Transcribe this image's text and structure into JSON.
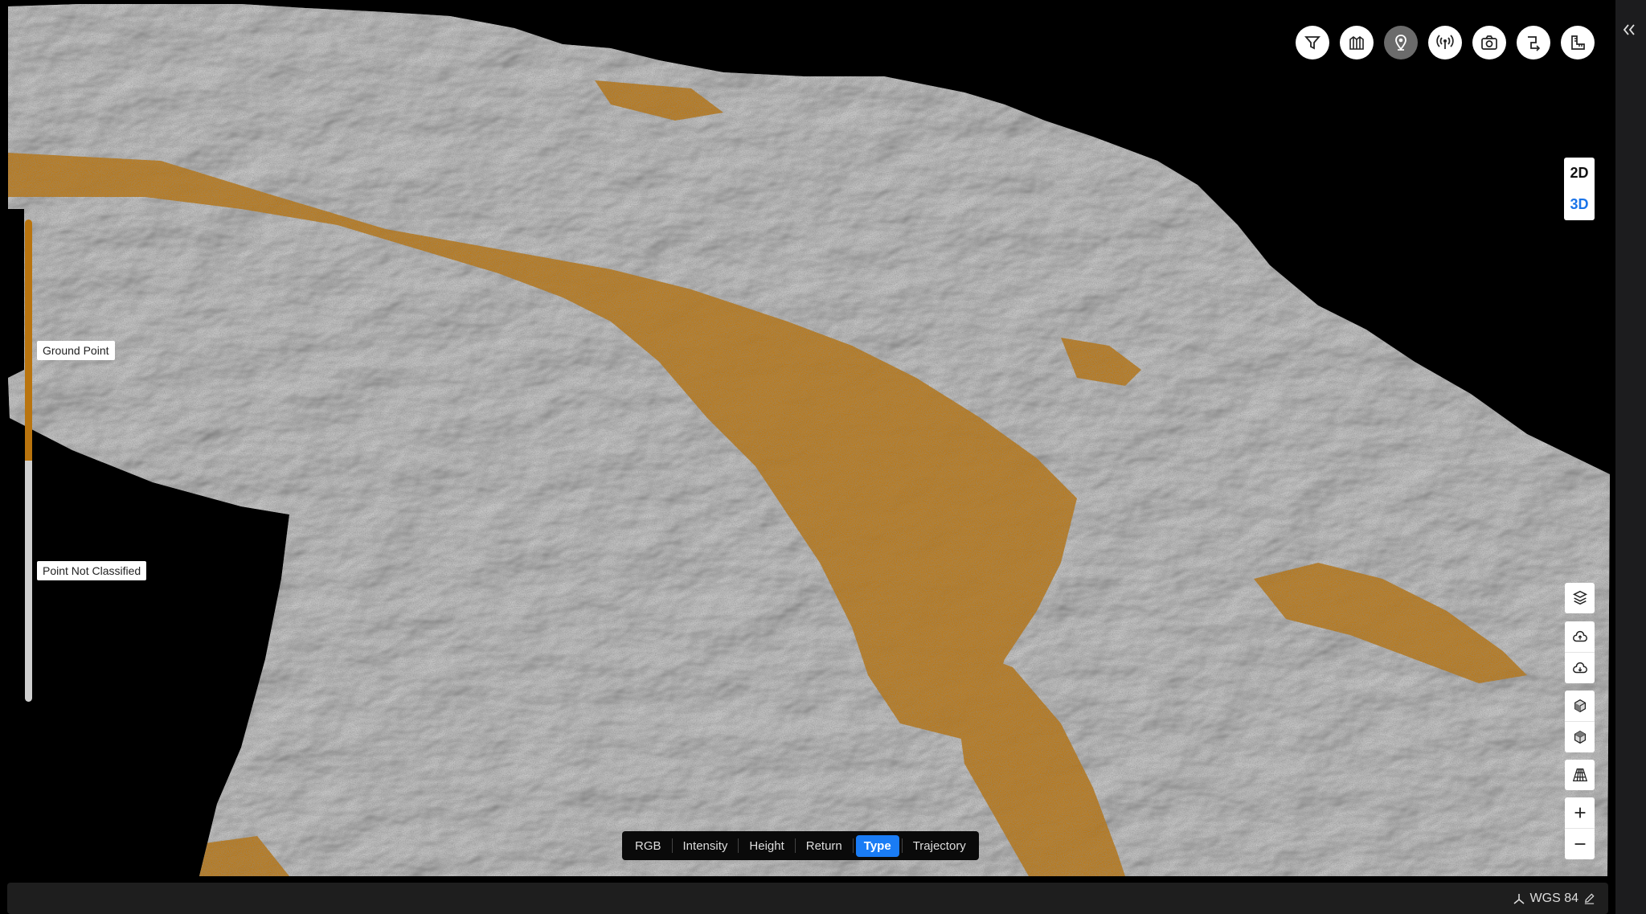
{
  "toolbar": {
    "buttons": [
      {
        "icon": "filter-icon",
        "active": false
      },
      {
        "icon": "map-icon",
        "active": false
      },
      {
        "icon": "location-pin-icon",
        "active": true
      },
      {
        "icon": "antenna-icon",
        "active": false
      },
      {
        "icon": "camera-icon",
        "active": false
      },
      {
        "icon": "route-icon",
        "active": false
      },
      {
        "icon": "measure-icon",
        "active": false
      }
    ]
  },
  "view_mode": {
    "options": [
      "2D",
      "3D"
    ],
    "selected": "3D"
  },
  "legend": {
    "items": [
      {
        "label": "Ground Point",
        "color": "#b9740e"
      },
      {
        "label": "Point Not Classified",
        "color": "#cfcfcf"
      }
    ]
  },
  "colorize": {
    "modes": [
      "RGB",
      "Intensity",
      "Height",
      "Return",
      "Type",
      "Trajectory"
    ],
    "selected": "Type",
    "accent": "#1a7cf5"
  },
  "side_controls": {
    "icons": [
      "layers-icon",
      "cloud-upload-icon",
      "cloud-download-icon",
      "cube-top-icon",
      "cube-bottom-icon",
      "grid-perspective-icon",
      "zoom-in-icon",
      "zoom-out-icon"
    ]
  },
  "status_bar": {
    "crs_label": "WGS 84"
  }
}
